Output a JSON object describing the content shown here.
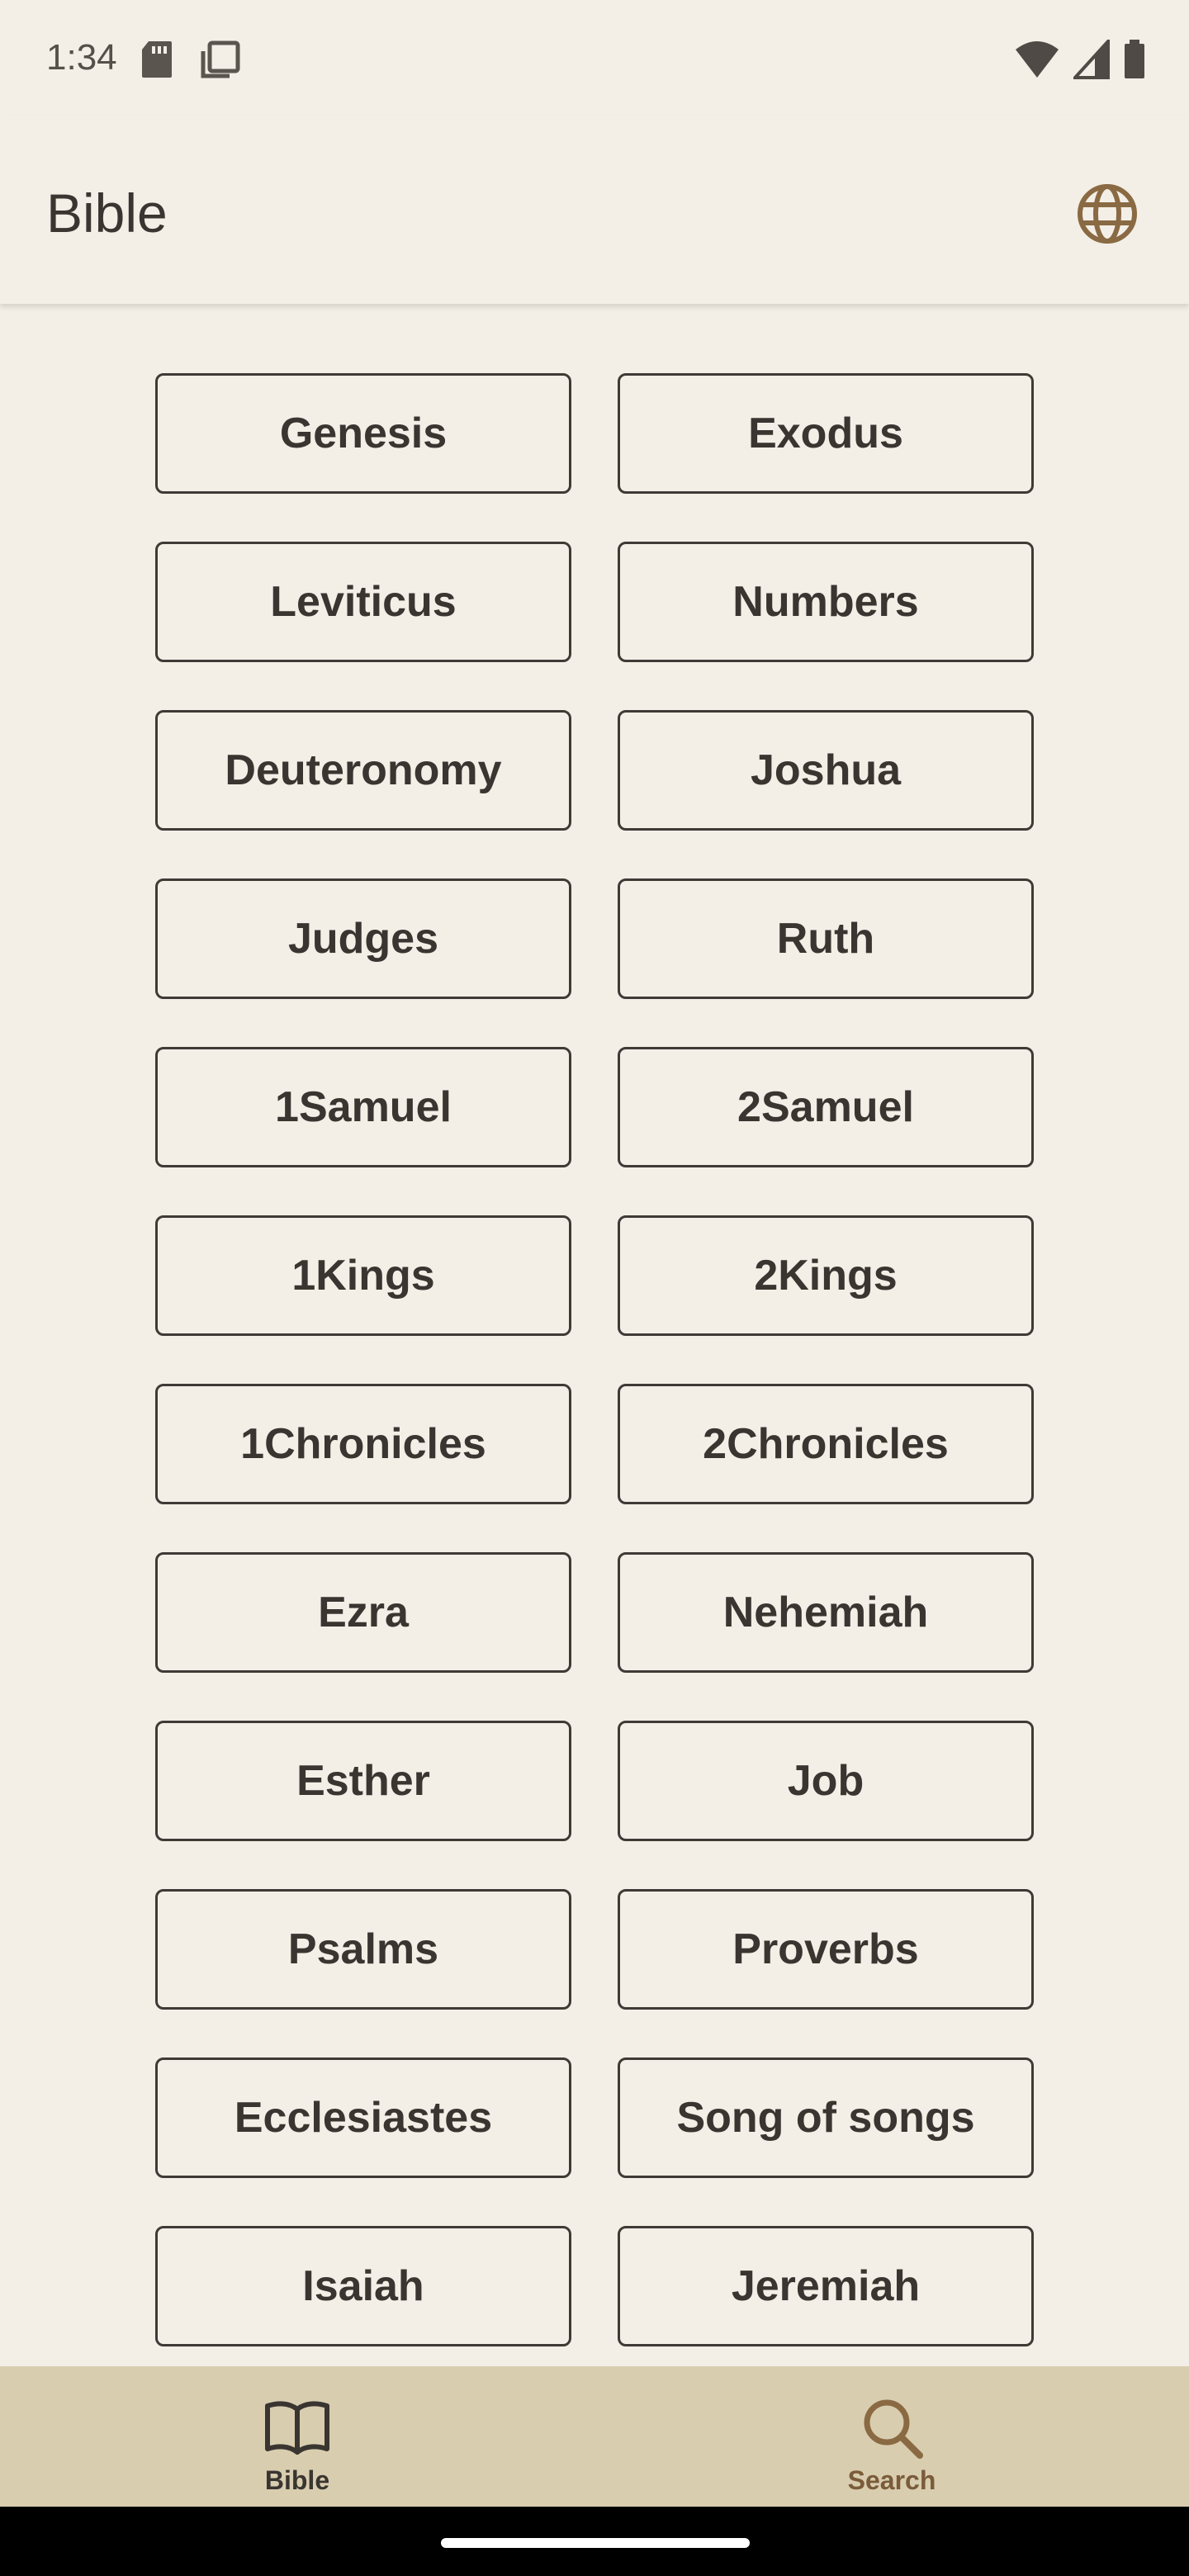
{
  "status_bar": {
    "time": "1:34"
  },
  "app_bar": {
    "title": "Bible",
    "language_icon": "globe-icon"
  },
  "books": [
    "Genesis",
    "Exodus",
    "Leviticus",
    "Numbers",
    "Deuteronomy",
    "Joshua",
    "Judges",
    "Ruth",
    "1Samuel",
    "2Samuel",
    "1Kings",
    "2Kings",
    "1Chronicles",
    "2Chronicles",
    "Ezra",
    "Nehemiah",
    "Esther",
    "Job",
    "Psalms",
    "Proverbs",
    "Ecclesiastes",
    "Song of songs",
    "Isaiah",
    "Jeremiah"
  ],
  "bottom_nav": {
    "items": [
      {
        "label": "Bible",
        "icon": "open-book-icon",
        "active": true
      },
      {
        "label": "Search",
        "icon": "search-icon",
        "active": false
      }
    ]
  },
  "colors": {
    "background": "#f3efe7",
    "text": "#3a3530",
    "border": "#3f3a35",
    "nav_background": "#d9cdb0",
    "accent": "#7a5c3a"
  }
}
